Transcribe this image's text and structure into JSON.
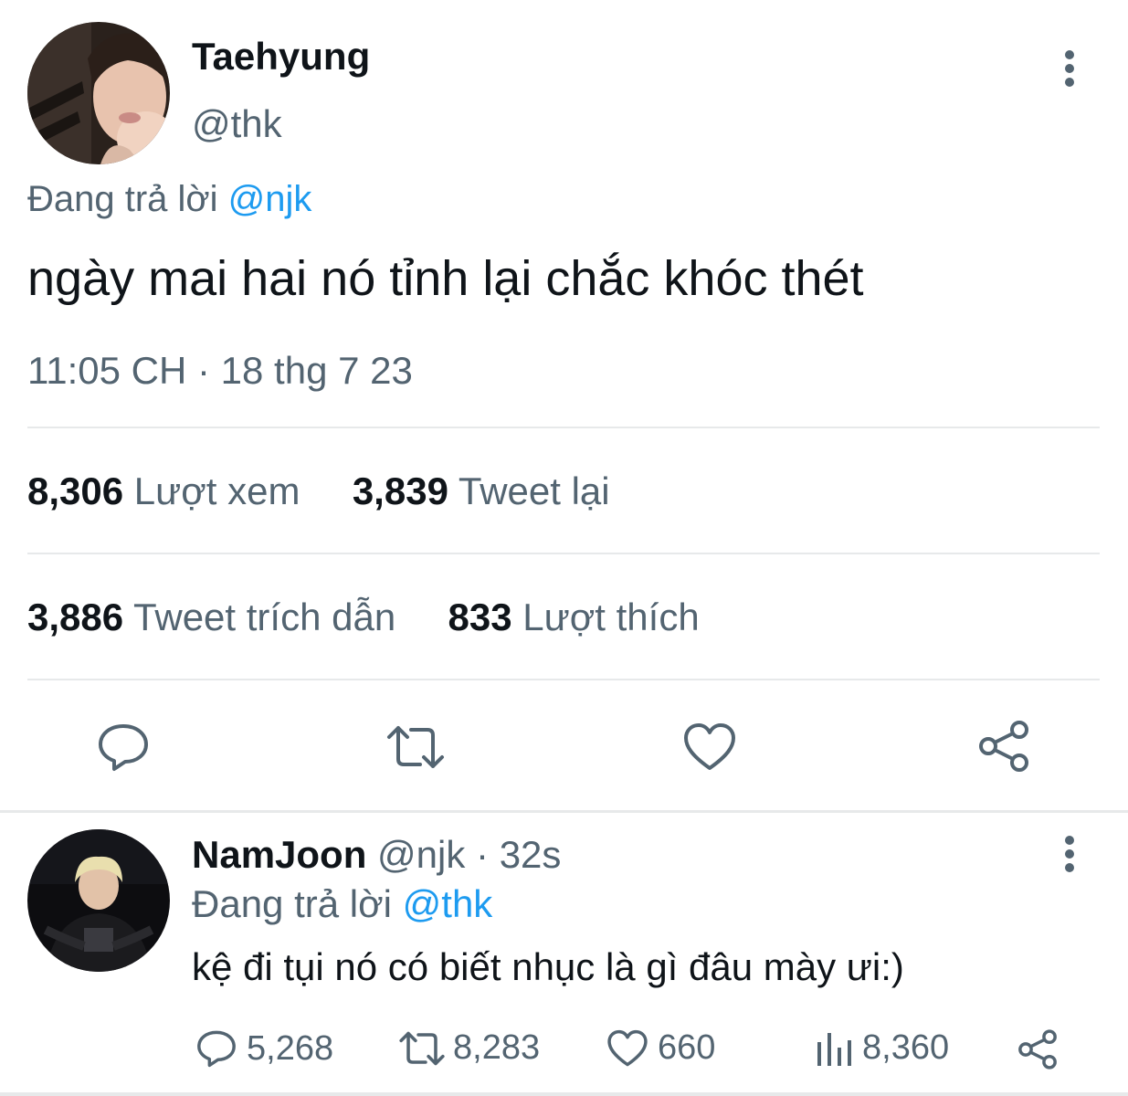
{
  "tweet": {
    "display_name": "Taehyung",
    "handle": "@thk",
    "reply_prefix": "Đang trả lời",
    "reply_to": "@njk",
    "text": "ngày mai hai nó tỉnh lại chắc khóc thét",
    "time": "11:05 CH",
    "date_sep": "·",
    "date": "18 thg 7 23",
    "stats": {
      "views_count": "8,306",
      "views_label": "Lượt xem",
      "retweets_count": "3,839",
      "retweets_label": "Tweet lại",
      "quotes_count": "3,886",
      "quotes_label": "Tweet trích dẫn",
      "likes_count": "833",
      "likes_label": "Lượt thích"
    },
    "icons": [
      "reply-icon",
      "retweet-icon",
      "like-icon",
      "share-icon",
      "more-icon"
    ]
  },
  "reply": {
    "display_name": "NamJoon",
    "handle": "@njk",
    "sep": "·",
    "age": "32s",
    "reply_prefix": "Đang trả lời",
    "reply_to": "@thk",
    "text": "kệ đi tụi nó có biết nhục là gì đâu mày ưi:)",
    "counts": {
      "replies": "5,268",
      "retweets": "8,283",
      "likes": "660",
      "views": "8,360"
    }
  },
  "colors": {
    "text": "#0f1419",
    "secondary": "#536471",
    "link": "#1d9bf0",
    "divider": "#e7e9ea"
  }
}
